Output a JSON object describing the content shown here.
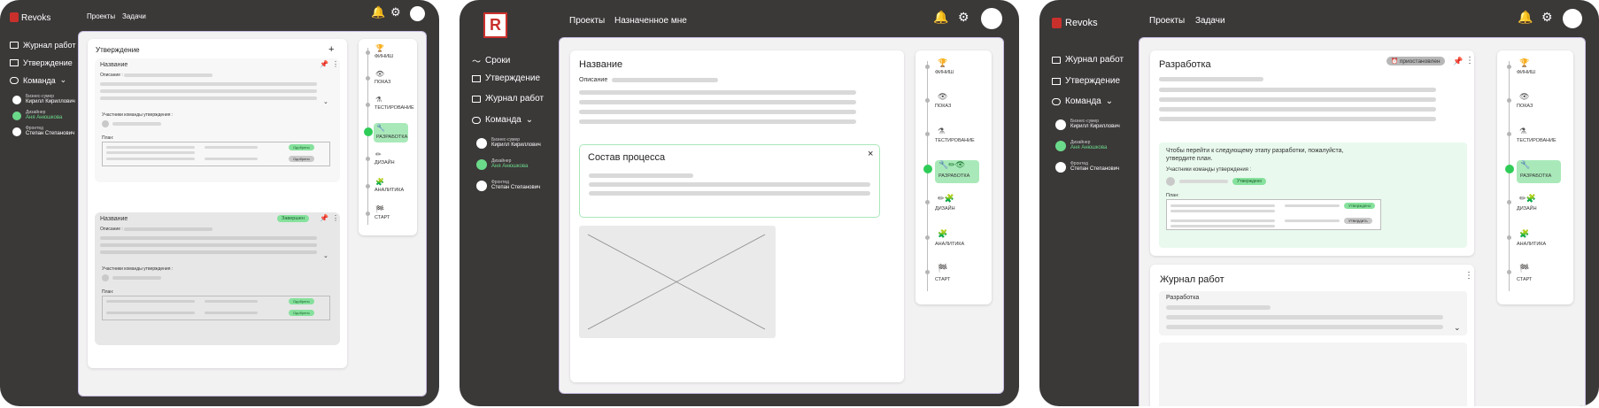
{
  "app": {
    "name": "Revoks",
    "logo_letter": "R"
  },
  "nav": {
    "projects": "Проекты",
    "tasks": "Задачи",
    "assigned": "Назначенное мне"
  },
  "sidebar": {
    "deadlines": "Сроки",
    "approval": "Утверждение",
    "journal": "Журнал работ",
    "team": "Команда"
  },
  "team": [
    {
      "role": "Бизнес-сумер",
      "name": "Кирилл Кириллович"
    },
    {
      "role": "Дизайнер",
      "name": "Аня Анюшкова"
    },
    {
      "role": "Фронтед",
      "name": "Степан Степанович"
    }
  ],
  "screen1": {
    "panel_title": "Утверждение",
    "card1_title": "Название",
    "description": "Описание :",
    "members": "Участники команды утверждения :",
    "plan": "План:",
    "approved": "Одобрено",
    "card2_title": "Название",
    "card2_badge": "Завершен"
  },
  "screen2": {
    "title": "Название",
    "description": "Описание",
    "process": "Состав процесса"
  },
  "screen3": {
    "title": "Разработка",
    "status": "приостановлен",
    "notice": "Чтобы перейти к следующему этапу разработки, пожалуйста, утвердите план.",
    "members": "Участники команды утверждения :",
    "approved": "Утверждено",
    "plan": "План:",
    "approve": "Утвердить",
    "journal_title": "Журнал работ",
    "journal_item": "Разработка"
  },
  "stages": {
    "finish": "ФИНИШ",
    "show": "ПОКАЗ",
    "testing": "ТЕСТИРОВАНИЕ",
    "dev": "РАЗРАБОТКА",
    "design": "ДИЗАЙН",
    "analytics": "АНАЛИТИКА",
    "start": "СТАРТ"
  },
  "colors": {
    "frame": "#3b3838",
    "accent": "#2ecc57",
    "brand": "#c9302c",
    "border": "#c7bce0"
  }
}
